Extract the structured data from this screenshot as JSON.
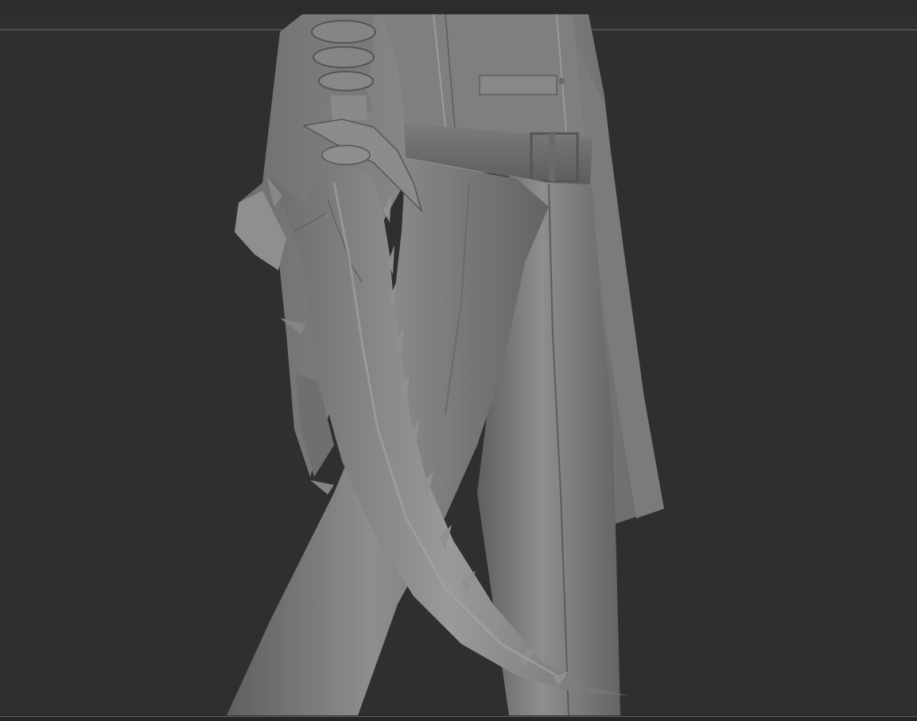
{
  "app": {
    "view": "3d-sculpt-viewport"
  },
  "viewport": {
    "background_color": "#2f2f2f",
    "model_color": "#8a8a8a",
    "guide_line_color": "#6a6a6a"
  },
  "model": {
    "parts": [
      "coat",
      "trousers",
      "belt",
      "gloved-hand",
      "curved-spiked-blade"
    ]
  }
}
